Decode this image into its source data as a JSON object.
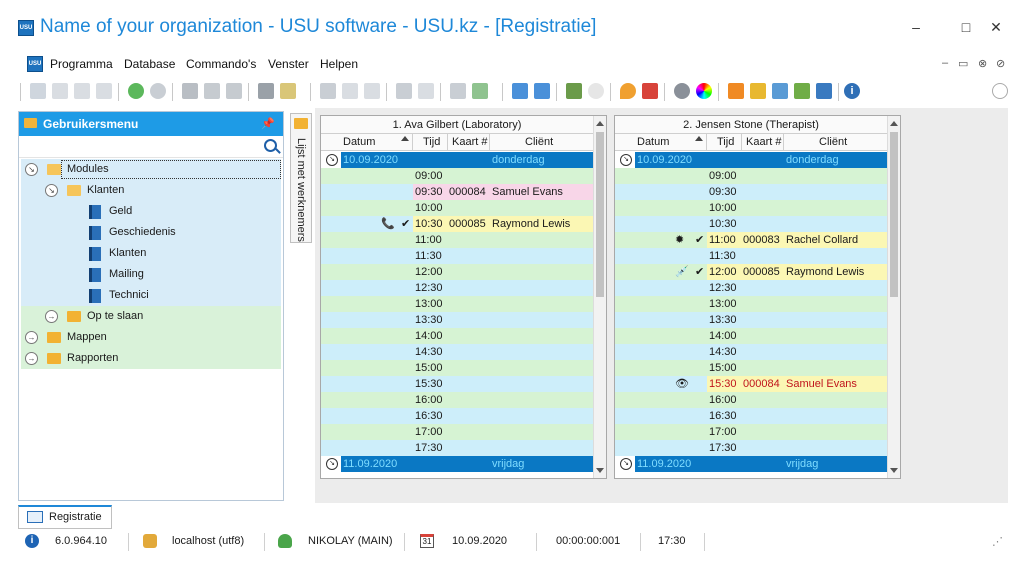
{
  "window": {
    "title": "Name of your organization - USU software - USU.kz - [Registratie]",
    "app_icon_text": "USU",
    "minimize": "–",
    "maximize": "□",
    "close": "✕"
  },
  "menu": {
    "items": [
      "Programma",
      "Database",
      "Commando's",
      "Venster",
      "Helpen"
    ],
    "mdi_controls": [
      "–",
      "▭",
      "⊗"
    ]
  },
  "sidebar": {
    "header": "Gebruikersmenu",
    "pin": "ᵖ",
    "vertical_tab": "Lijst met werknemers",
    "tree": [
      {
        "label": "Modules",
        "level": 0,
        "kind": "folder-open",
        "expander": "down",
        "selected": true
      },
      {
        "label": "Klanten",
        "level": 1,
        "kind": "folder-open",
        "expander": "down"
      },
      {
        "label": "Geld",
        "level": 2,
        "kind": "book"
      },
      {
        "label": "Geschiedenis",
        "level": 2,
        "kind": "book"
      },
      {
        "label": "Klanten",
        "level": 2,
        "kind": "book"
      },
      {
        "label": "Mailing",
        "level": 2,
        "kind": "book"
      },
      {
        "label": "Technici",
        "level": 2,
        "kind": "book"
      },
      {
        "label": "Op te slaan",
        "level": 1,
        "kind": "folder",
        "expander": "right"
      },
      {
        "label": "Mappen",
        "level": 0,
        "kind": "folder",
        "expander": "right"
      },
      {
        "label": "Rapporten",
        "level": 0,
        "kind": "folder",
        "expander": "right"
      }
    ]
  },
  "schedules": [
    {
      "title": "1. Ava Gilbert (Laboratory)",
      "columns": [
        "Datum",
        "Tijd",
        "Kaart #",
        "Cliënt"
      ],
      "date_top": {
        "date": "10.09.2020",
        "day": "donderdag"
      },
      "date_bottom": {
        "date": "11.09.2020",
        "day": "vrijdag"
      },
      "rows": [
        {
          "time": "09:00",
          "card": "",
          "client": "",
          "hl": "",
          "icon": "",
          "check": ""
        },
        {
          "time": "09:30",
          "card": "000084",
          "client": "Samuel Evans",
          "hl": "pink",
          "icon": "",
          "check": ""
        },
        {
          "time": "10:00",
          "card": "",
          "client": "",
          "hl": "",
          "icon": "",
          "check": ""
        },
        {
          "time": "10:30",
          "card": "000085",
          "client": "Raymond Lewis",
          "hl": "yellow",
          "icon": "📞",
          "check": "✔"
        },
        {
          "time": "11:00",
          "card": "",
          "client": "",
          "hl": "",
          "icon": "",
          "check": ""
        },
        {
          "time": "11:30",
          "card": "",
          "client": "",
          "hl": "",
          "icon": "",
          "check": ""
        },
        {
          "time": "12:00",
          "card": "",
          "client": "",
          "hl": "",
          "icon": "",
          "check": ""
        },
        {
          "time": "12:30",
          "card": "",
          "client": "",
          "hl": "",
          "icon": "",
          "check": ""
        },
        {
          "time": "13:00",
          "card": "",
          "client": "",
          "hl": "",
          "icon": "",
          "check": ""
        },
        {
          "time": "13:30",
          "card": "",
          "client": "",
          "hl": "",
          "icon": "",
          "check": ""
        },
        {
          "time": "14:00",
          "card": "",
          "client": "",
          "hl": "",
          "icon": "",
          "check": ""
        },
        {
          "time": "14:30",
          "card": "",
          "client": "",
          "hl": "",
          "icon": "",
          "check": ""
        },
        {
          "time": "15:00",
          "card": "",
          "client": "",
          "hl": "",
          "icon": "",
          "check": ""
        },
        {
          "time": "15:30",
          "card": "",
          "client": "",
          "hl": "",
          "icon": "",
          "check": ""
        },
        {
          "time": "16:00",
          "card": "",
          "client": "",
          "hl": "",
          "icon": "",
          "check": ""
        },
        {
          "time": "16:30",
          "card": "",
          "client": "",
          "hl": "",
          "icon": "",
          "check": ""
        },
        {
          "time": "17:00",
          "card": "",
          "client": "",
          "hl": "",
          "icon": "",
          "check": ""
        },
        {
          "time": "17:30",
          "card": "",
          "client": "",
          "hl": "",
          "icon": "",
          "check": ""
        }
      ]
    },
    {
      "title": "2. Jensen Stone (Therapist)",
      "columns": [
        "Datum",
        "Tijd",
        "Kaart #",
        "Cliënt"
      ],
      "date_top": {
        "date": "10.09.2020",
        "day": "donderdag"
      },
      "date_bottom": {
        "date": "11.09.2020",
        "day": "vrijdag"
      },
      "rows": [
        {
          "time": "09:00",
          "card": "",
          "client": "",
          "hl": "",
          "icon": "",
          "check": ""
        },
        {
          "time": "09:30",
          "card": "",
          "client": "",
          "hl": "",
          "icon": "",
          "check": ""
        },
        {
          "time": "10:00",
          "card": "",
          "client": "",
          "hl": "",
          "icon": "",
          "check": ""
        },
        {
          "time": "10:30",
          "card": "",
          "client": "",
          "hl": "",
          "icon": "",
          "check": ""
        },
        {
          "time": "11:00",
          "card": "000083",
          "client": "Rachel Collard",
          "hl": "yellow",
          "icon": "✹",
          "check": "✔"
        },
        {
          "time": "11:30",
          "card": "",
          "client": "",
          "hl": "",
          "icon": "",
          "check": ""
        },
        {
          "time": "12:00",
          "card": "000085",
          "client": "Raymond Lewis",
          "hl": "yellow",
          "icon": "💉",
          "check": "✔"
        },
        {
          "time": "12:30",
          "card": "",
          "client": "",
          "hl": "",
          "icon": "",
          "check": ""
        },
        {
          "time": "13:00",
          "card": "",
          "client": "",
          "hl": "",
          "icon": "",
          "check": ""
        },
        {
          "time": "13:30",
          "card": "",
          "client": "",
          "hl": "",
          "icon": "",
          "check": ""
        },
        {
          "time": "14:00",
          "card": "",
          "client": "",
          "hl": "",
          "icon": "",
          "check": ""
        },
        {
          "time": "14:30",
          "card": "",
          "client": "",
          "hl": "",
          "icon": "",
          "check": ""
        },
        {
          "time": "15:00",
          "card": "",
          "client": "",
          "hl": "",
          "icon": "",
          "check": ""
        },
        {
          "time": "15:30",
          "card": "000084",
          "client": "Samuel Evans",
          "hl": "yellow-red",
          "icon": "👁",
          "check": ""
        },
        {
          "time": "16:00",
          "card": "",
          "client": "",
          "hl": "",
          "icon": "",
          "check": ""
        },
        {
          "time": "16:30",
          "card": "",
          "client": "",
          "hl": "",
          "icon": "",
          "check": ""
        },
        {
          "time": "17:00",
          "card": "",
          "client": "",
          "hl": "",
          "icon": "",
          "check": ""
        },
        {
          "time": "17:30",
          "card": "",
          "client": "",
          "hl": "",
          "icon": "",
          "check": ""
        }
      ]
    }
  ],
  "bottom_tab": {
    "label": "Registratie"
  },
  "status": {
    "version": "6.0.964.10",
    "db": "localhost (utf8)",
    "user": "NIKOLAY (MAIN)",
    "date_icon": "31",
    "date": "10.09.2020",
    "timer": "00:00:00:001",
    "time": "17:30"
  },
  "colors": {
    "accent": "#1e9be6",
    "date_row": "#0a78c4",
    "row_blue": "#cdeefa",
    "row_green": "#d6f3d3",
    "hl_pink": "#f8d6e8",
    "hl_yellow": "#fbf7b4"
  }
}
